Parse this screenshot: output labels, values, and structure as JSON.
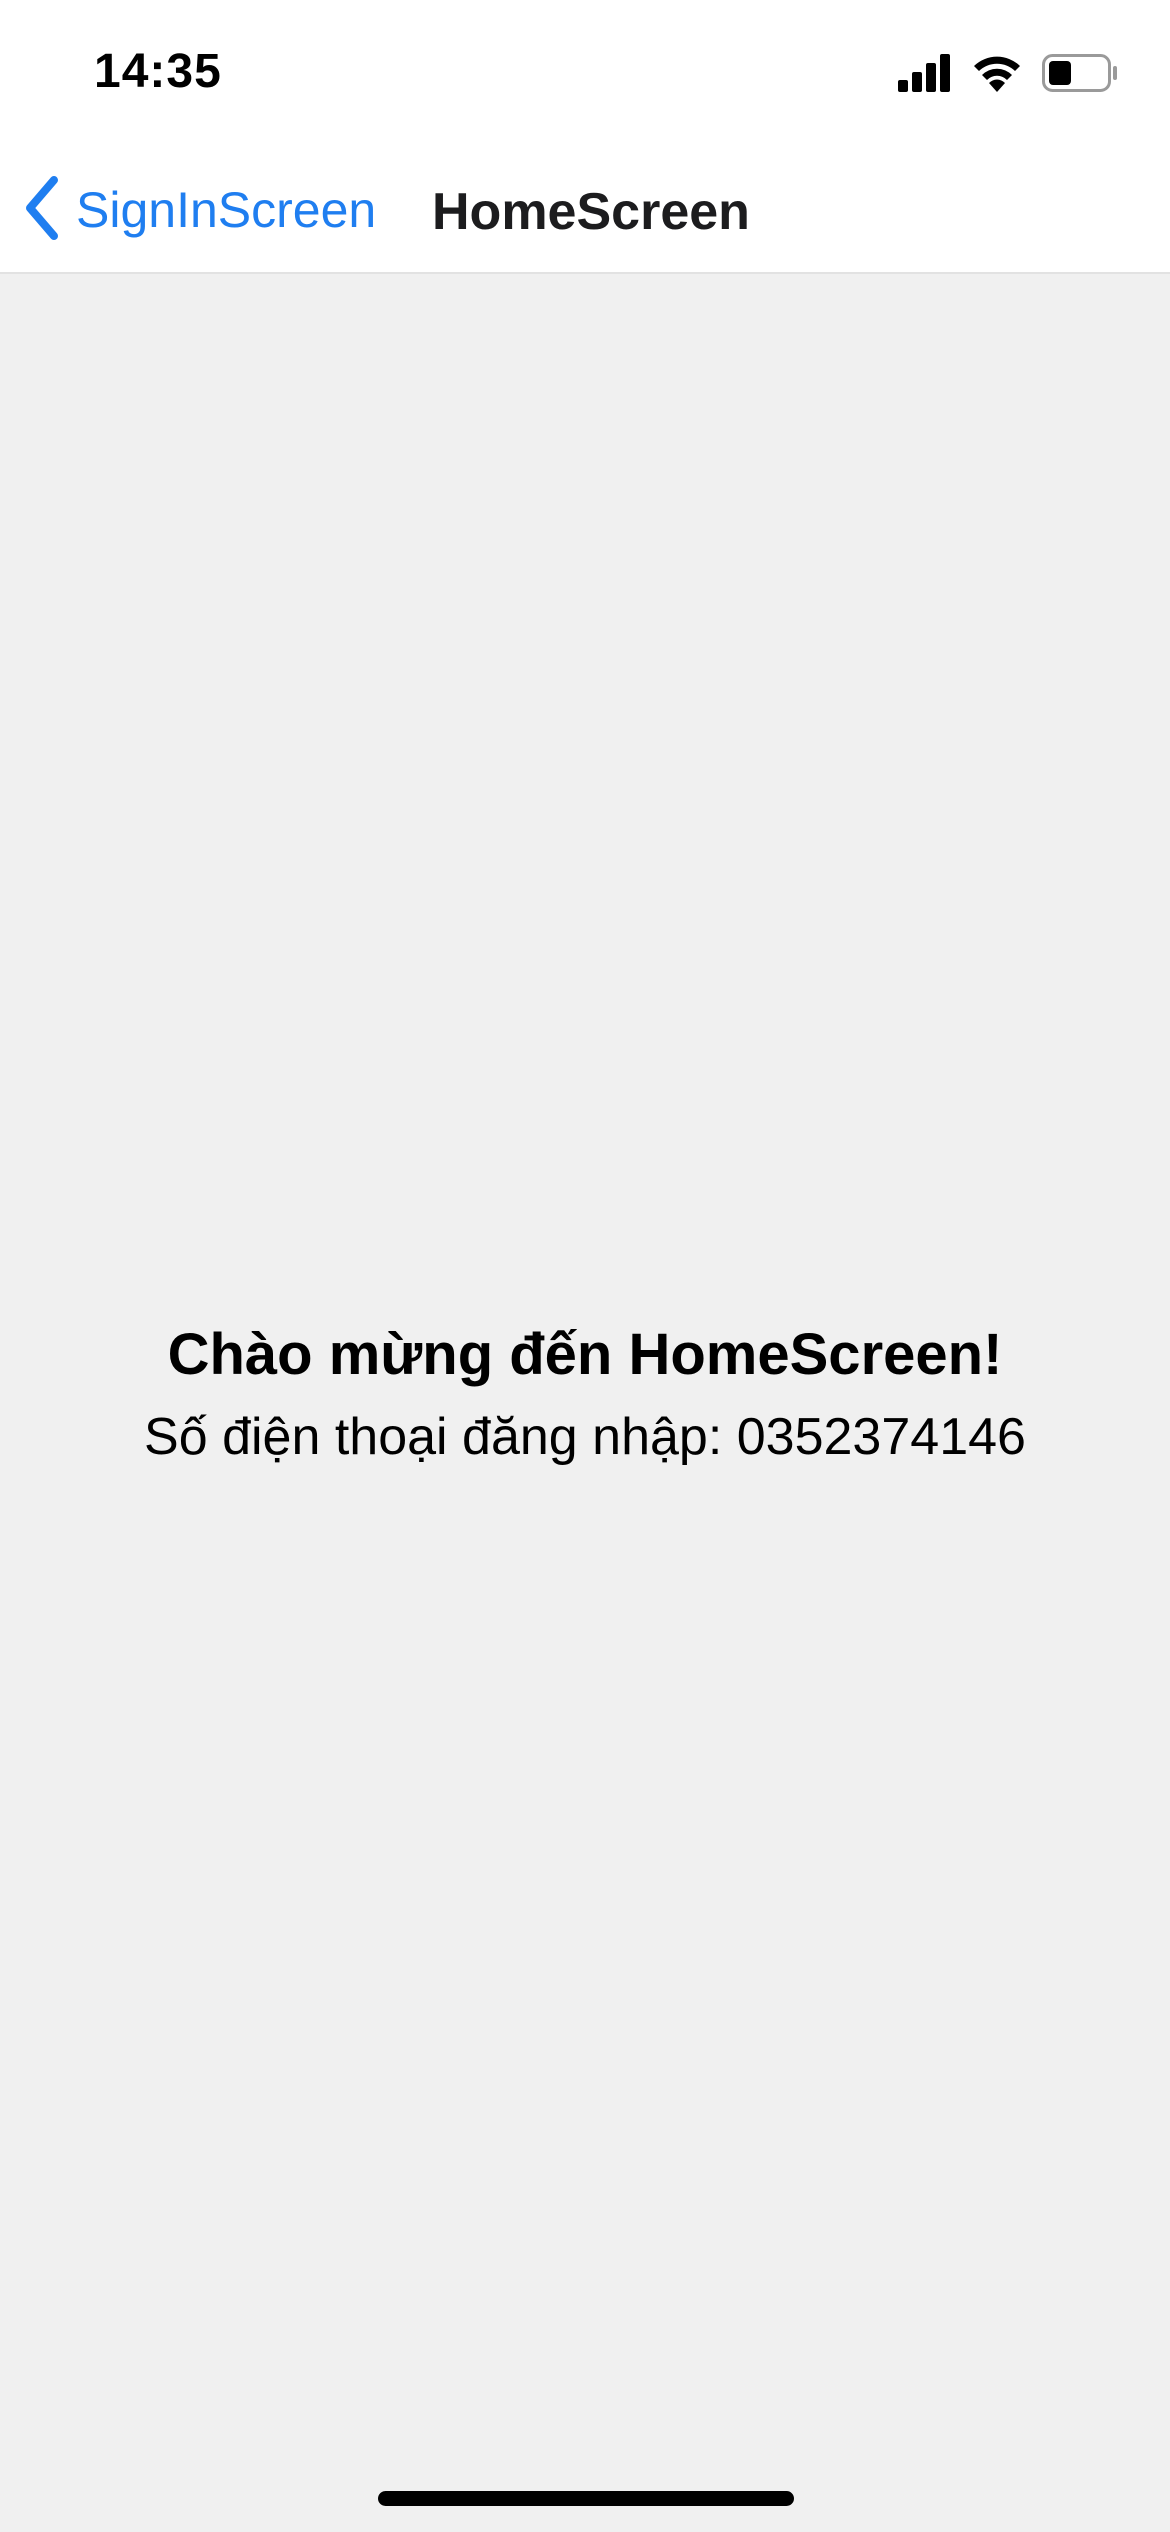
{
  "status_bar": {
    "time": "14:35",
    "icons": [
      "cellular-signal-icon",
      "wifi-icon",
      "battery-icon"
    ],
    "battery_level": 0.4
  },
  "nav_bar": {
    "back_label": "SignInScreen",
    "title": "HomeScreen",
    "accent_color": "#1f7ef0"
  },
  "main": {
    "welcome_text": "Chào mừng đến HomeScreen!",
    "phone_text": "Số điện thoại đăng nhập: 0352374146"
  }
}
